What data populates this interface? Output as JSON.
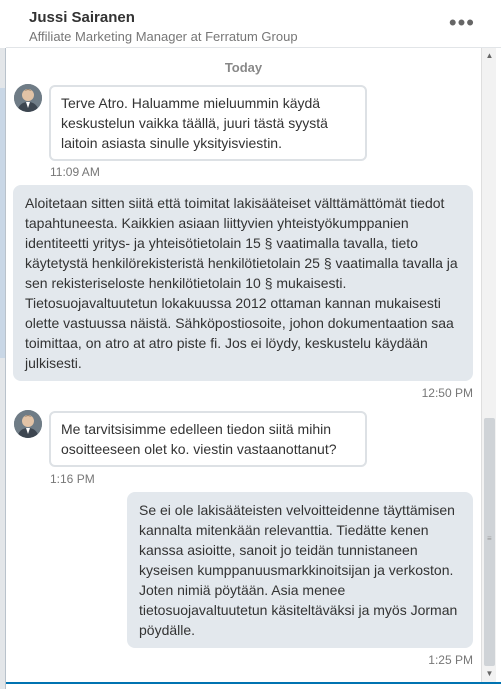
{
  "header": {
    "name": "Jussi Sairanen",
    "subtitle": "Affiliate Marketing Manager at Ferratum Group",
    "more_icon": "more-horizontal-icon",
    "more_glyph": "•••"
  },
  "chat": {
    "date_divider": "Today",
    "messages": [
      {
        "direction": "incoming",
        "text": "Terve Atro. Haluamme mieluummin käydä keskustelun vaikka täällä, juuri tästä syystä laitoin asiasta sinulle yksityisviestin.",
        "time": "11:09 AM"
      },
      {
        "direction": "outgoing",
        "text": "Aloitetaan sitten siitä että toimitat lakisääteiset välttämättömät tiedot tapahtuneesta. Kaikkien asiaan liittyvien yhteistyökumppanien identiteetti yritys- ja yhteisötietolain 15 § vaatimalla tavalla, tieto käytetystä henkilörekisteristä henkilötietolain 25 § vaatimalla tavalla ja sen rekisteriseloste henkilötietolain 10 § mukaisesti. Tietosuojavaltuutetun lokakuussa 2012 ottaman kannan mukaisesti olette vastuussa näistä. Sähköpostiosoite, johon dokumentaation saa toimittaa, on atro at atro piste fi. Jos ei löydy, keskustelu käydään julkisesti.",
        "time": "12:50 PM"
      },
      {
        "direction": "incoming",
        "text": "Me tarvitsisimme edelleen tiedon siitä mihin osoitteeseen olet ko. viestin vastaanottanut?",
        "time": "1:16 PM"
      },
      {
        "direction": "outgoing",
        "text": "Se ei ole lakisääteisten velvoitteidenne täyttämisen kannalta mitenkään relevanttia. Tiedätte kenen kanssa asioitte, sanoit jo teidän tunnistaneen kyseisen kumppanuusmarkkinoitsijan ja verkoston. Joten nimiä pöytään. Asia menee tietosuojavaltuutetun käsiteltäväksi ja myös Jorman pöydälle.",
        "time": "1:25 PM"
      }
    ]
  },
  "scrollbar": {
    "up_glyph": "▲",
    "down_glyph": "▼",
    "grip_glyph": "≡",
    "position_fraction": 0.6
  },
  "colors": {
    "accent": "#0073b1",
    "outgoing_bubble": "#e3e8ed",
    "incoming_border": "#dde1e5"
  }
}
